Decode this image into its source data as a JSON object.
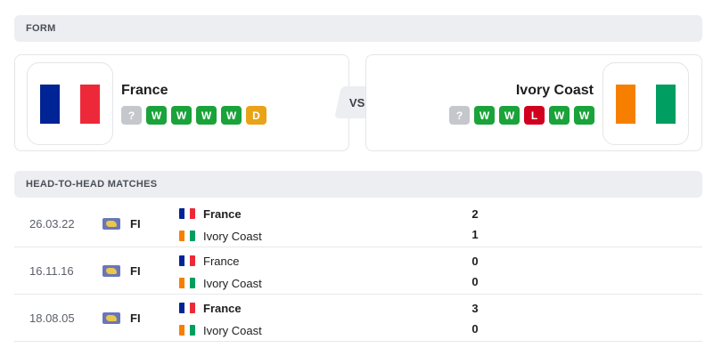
{
  "form": {
    "header": "FORM",
    "home": {
      "name": "France",
      "flag_colors": [
        "#002395",
        "#ffffff",
        "#ed2939"
      ],
      "results": [
        {
          "label": "?",
          "type": "U"
        },
        {
          "label": "W",
          "type": "W"
        },
        {
          "label": "W",
          "type": "W"
        },
        {
          "label": "W",
          "type": "W"
        },
        {
          "label": "W",
          "type": "W"
        },
        {
          "label": "D",
          "type": "D"
        }
      ]
    },
    "away": {
      "name": "Ivory Coast",
      "flag_colors": [
        "#f77f00",
        "#ffffff",
        "#009e60"
      ],
      "results": [
        {
          "label": "?",
          "type": "U"
        },
        {
          "label": "W",
          "type": "W"
        },
        {
          "label": "W",
          "type": "W"
        },
        {
          "label": "L",
          "type": "L"
        },
        {
          "label": "W",
          "type": "W"
        },
        {
          "label": "W",
          "type": "W"
        }
      ]
    },
    "vs_label": "VS"
  },
  "h2h": {
    "header": "HEAD-TO-HEAD MATCHES",
    "matches": [
      {
        "date": "26.03.22",
        "competition": "FI",
        "competition_icon": "world-icon",
        "home": {
          "name": "France",
          "score": "2",
          "winner": true
        },
        "away": {
          "name": "Ivory Coast",
          "score": "1",
          "winner": false
        }
      },
      {
        "date": "16.11.16",
        "competition": "FI",
        "competition_icon": "world-icon",
        "home": {
          "name": "France",
          "score": "0",
          "winner": false
        },
        "away": {
          "name": "Ivory Coast",
          "score": "0",
          "winner": false
        }
      },
      {
        "date": "18.08.05",
        "competition": "FI",
        "competition_icon": "world-icon",
        "home": {
          "name": "France",
          "score": "3",
          "winner": true
        },
        "away": {
          "name": "Ivory Coast",
          "score": "0",
          "winner": false
        }
      }
    ]
  }
}
